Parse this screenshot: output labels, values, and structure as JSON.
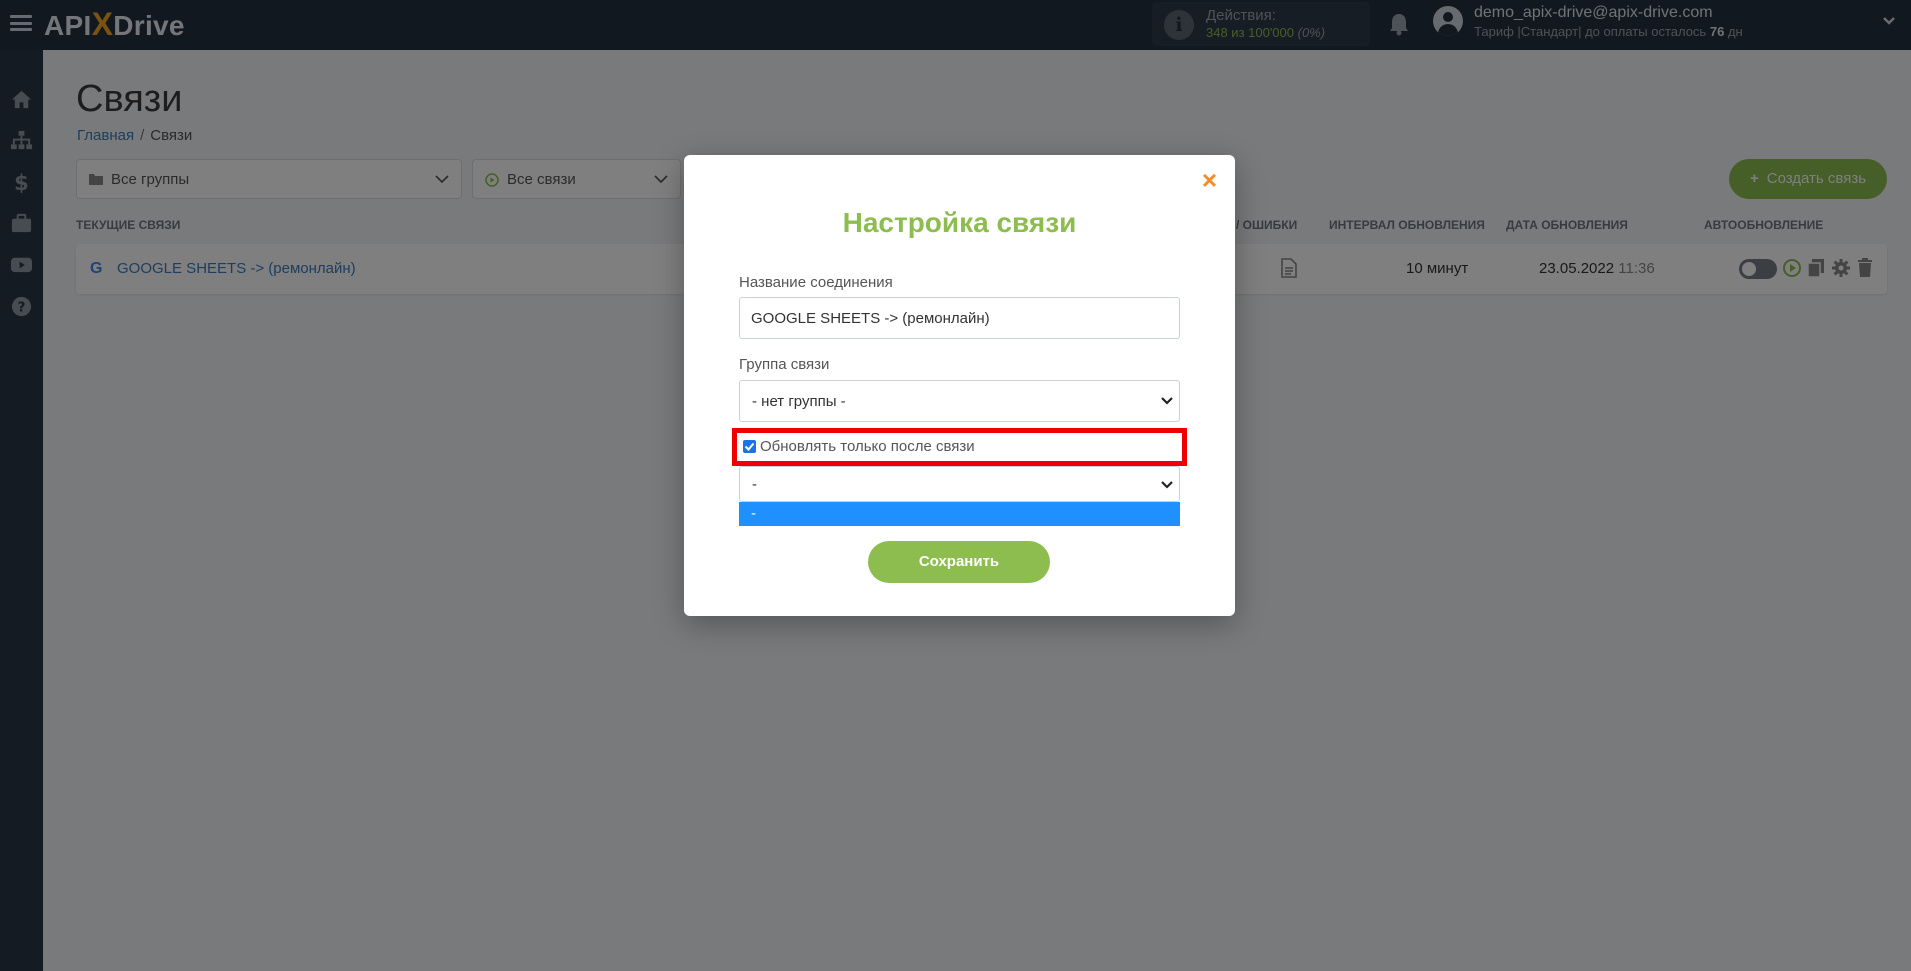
{
  "header": {
    "logo_left": "API",
    "logo_x": "X",
    "logo_right": "Drive",
    "actions_title": "Действия:",
    "actions_used": "348 из 100'000",
    "actions_percent": "(0%)",
    "user_email": "demo_apix-drive@apix-drive.com",
    "plan_prefix": "Тариф |Стандарт| до оплаты осталось",
    "plan_days": "76",
    "plan_suffix": "дн"
  },
  "sidebar": {
    "icons": [
      "home-icon",
      "sitemap-icon",
      "dollar-icon",
      "briefcase-icon",
      "youtube-icon",
      "question-icon"
    ]
  },
  "page": {
    "title": "Связи",
    "breadcrumb_home": "Главная",
    "breadcrumb_sep": "/",
    "breadcrumb_current": "Связи"
  },
  "filters": {
    "groups": "Все группы",
    "connections": "Все связи"
  },
  "create_button": "Создать связь",
  "table": {
    "columns": {
      "current": "ТЕКУЩИЕ СВЯЗИ",
      "errors": "/ ОШИБКИ",
      "interval": "ИНТЕРВАЛ ОБНОВЛЕНИЯ",
      "date": "ДАТА ОБНОВЛЕНИЯ",
      "auto": "АВТООБНОВЛЕНИЕ"
    },
    "rows": [
      {
        "name": "GOOGLE SHEETS -> (ремонлайн)",
        "interval": "10 минут",
        "date": "23.05.2022",
        "time": "11:36",
        "auto_update": false
      }
    ]
  },
  "modal": {
    "close": "×",
    "title": "Настройка связи",
    "name_label": "Название соединения",
    "name_value": "GOOGLE SHEETS -> (ремонлайн)",
    "group_label": "Группа связи",
    "group_value": "- нет группы -",
    "checkbox_label": "Обновлять только после связи",
    "checkbox_checked": true,
    "after_select_value": "-",
    "dropdown_option": "-",
    "save_button": "Сохранить"
  },
  "colors": {
    "accent_green": "#8dbd4f",
    "topbar": "#24303e",
    "highlight": "#ee0000",
    "close": "#f28c28"
  }
}
